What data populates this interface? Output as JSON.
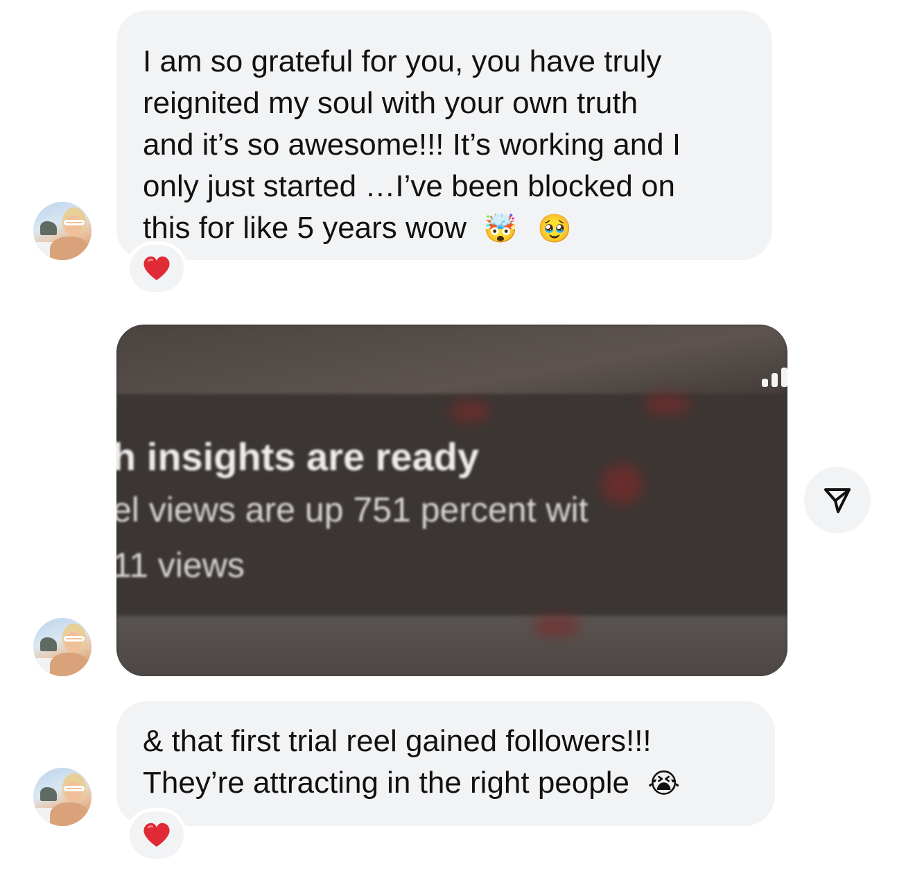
{
  "messages": [
    {
      "type": "text",
      "text": "I am so grateful for you, you have truly\nreignited my soul with your own truth\nand it’s so awesome!!! It’s working and I\nonly just started …I’ve been blocked on\nthis for like 5 years wow",
      "emojis": [
        "🤯",
        "🥹"
      ],
      "reaction": "❤️"
    },
    {
      "type": "image",
      "image_text": {
        "line1": "h insights are ready",
        "line2": "el views are up 751 percent wit",
        "line3": "11 views"
      }
    },
    {
      "type": "text",
      "text": "& that first trial reel gained followers!!!\nThey’re attracting in the right people",
      "emojis": [
        "😭"
      ],
      "reaction": "❤️"
    }
  ],
  "colors": {
    "bubble": "#f2f3f5",
    "text": "#111111",
    "heart": "#e02a35"
  },
  "icons": {
    "avatar": "profile-avatar",
    "reaction": "red-heart-icon",
    "share": "share-send-icon"
  }
}
